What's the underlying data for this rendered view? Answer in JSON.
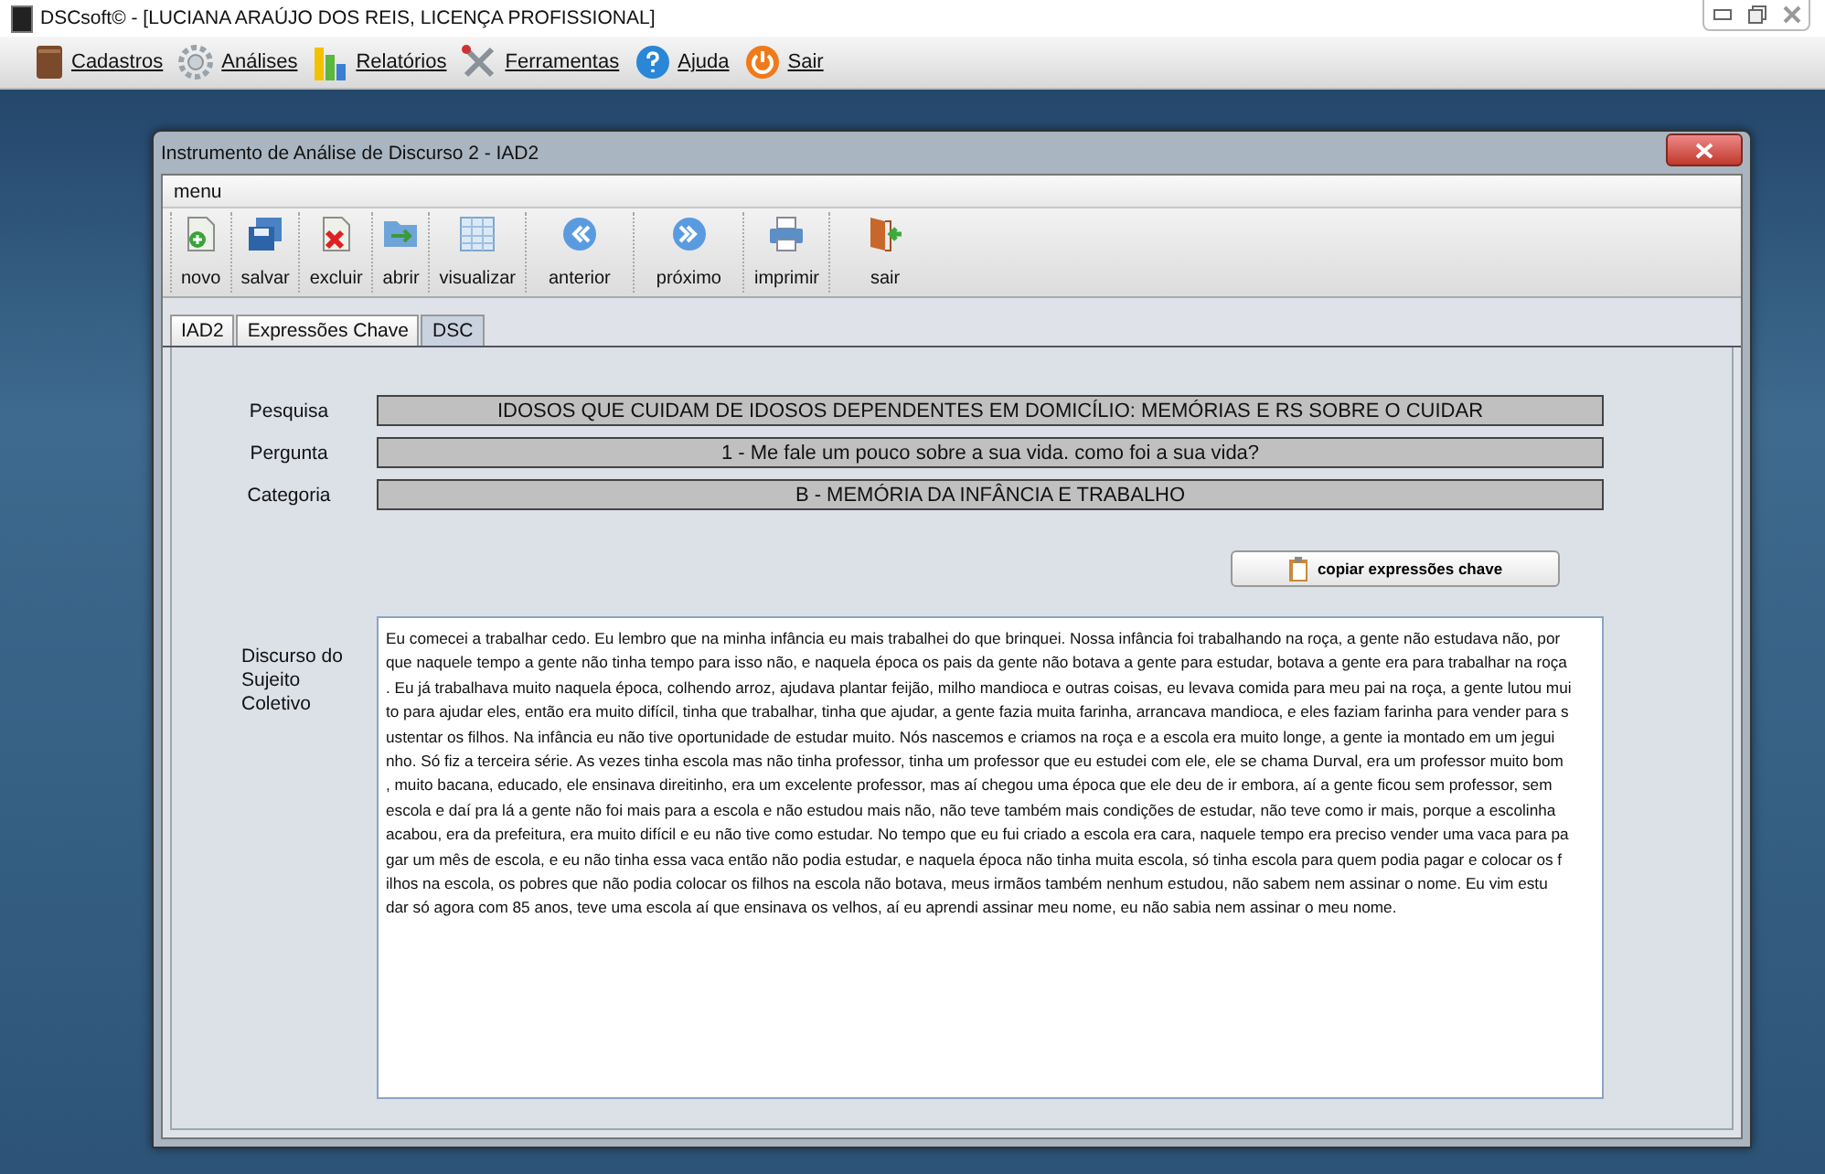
{
  "app": {
    "title": "DSCsoft© - [LUCIANA ARAÚJO DOS REIS,  LICENÇA PROFISSIONAL]"
  },
  "main_menu": [
    {
      "label": "Cadastros",
      "kind": "book"
    },
    {
      "label": "Análises",
      "kind": "gear"
    },
    {
      "label": "Relatórios",
      "kind": "chart"
    },
    {
      "label": "Ferramentas",
      "kind": "tools"
    },
    {
      "label": "Ajuda",
      "kind": "help"
    },
    {
      "label": "Sair",
      "kind": "power"
    }
  ],
  "window": {
    "title": "Instrumento de Análise de Discurso 2 - IAD2",
    "menu": "menu"
  },
  "toolbar": [
    {
      "label": "novo",
      "kind": "new"
    },
    {
      "label": "salvar",
      "kind": "save"
    },
    {
      "label": "excluir",
      "kind": "delete"
    },
    {
      "label": "abrir",
      "kind": "open"
    },
    {
      "label": "visualizar",
      "kind": "grid"
    },
    {
      "label": "anterior",
      "kind": "prev"
    },
    {
      "label": "próximo",
      "kind": "next"
    },
    {
      "label": "imprimir",
      "kind": "print"
    },
    {
      "label": "sair",
      "kind": "exit"
    }
  ],
  "tabs": [
    {
      "label": "IAD2",
      "selected": false
    },
    {
      "label": "Expressões Chave",
      "selected": false
    },
    {
      "label": "DSC",
      "selected": true
    }
  ],
  "fields": [
    {
      "label": "Pesquisa",
      "value": "IDOSOS QUE CUIDAM DE IDOSOS DEPENDENTES EM DOMICÍLIO: MEMÓRIAS E RS SOBRE O CUIDAR"
    },
    {
      "label": "Pergunta",
      "value": "1 - Me fale um pouco sobre a sua vida. como foi a sua vida?"
    },
    {
      "label": "Categoria",
      "value": "B - MEMÓRIA DA INFÂNCIA E TRABALHO"
    }
  ],
  "copy_button": "copiar expressões chave",
  "discourse": {
    "label_lines": [
      "Discurso do",
      "Sujeito",
      "Coletivo"
    ],
    "lines": [
      "Eu comecei a trabalhar cedo. Eu lembro que na minha infância eu mais trabalhei do que brinquei. Nossa infância foi trabalhando na roça, a gente não estudava não, por",
      "que naquele tempo a gente não tinha tempo para isso não, e naquela época os pais da gente não botava a gente para estudar, botava a gente era para trabalhar na roça",
      ". Eu já trabalhava muito naquela época, colhendo arroz, ajudava plantar feijão, milho mandioca e outras coisas, eu levava comida para meu pai na roça, a gente lutou mui",
      "to para ajudar eles, então era muito difícil, tinha que trabalhar, tinha que ajudar, a gente fazia muita farinha, arrancava mandioca, e eles faziam farinha para vender para s",
      "ustentar os filhos. Na infância eu não tive oportunidade de estudar muito. Nós nascemos e criamos na roça e a escola era muito longe, a gente ia montado em um jegui",
      "nho. Só fiz a terceira série. As vezes tinha escola mas não tinha professor, tinha um professor que eu estudei com ele, ele se chama Durval, era um professor muito bom",
      ", muito bacana, educado, ele ensinava direitinho, era um excelente professor, mas aí chegou uma época que ele deu de ir embora, aí a gente ficou sem professor, sem",
      "escola e daí pra lá a gente não foi mais para a escola e não estudou mais não, não teve também mais condições de estudar, não teve como ir mais, porque a escolinha",
      "acabou, era da prefeitura, era muito difícil e eu não tive como estudar. No tempo que eu fui criado a escola era cara, naquele tempo era preciso vender uma vaca para pa",
      "gar um mês de escola, e eu não tinha essa vaca então não podia estudar, e naquela época não tinha muita escola, só tinha escola para quem podia pagar e colocar os f",
      "ilhos na escola, os pobres que não podia colocar os filhos na escola não botava, meus irmãos também nenhum estudou, não sabem nem assinar o nome. Eu vim estu",
      "dar só agora com 85 anos, teve uma escola aí que ensinava os velhos, aí eu aprendi assinar meu nome, eu não sabia nem assinar o meu nome."
    ]
  }
}
